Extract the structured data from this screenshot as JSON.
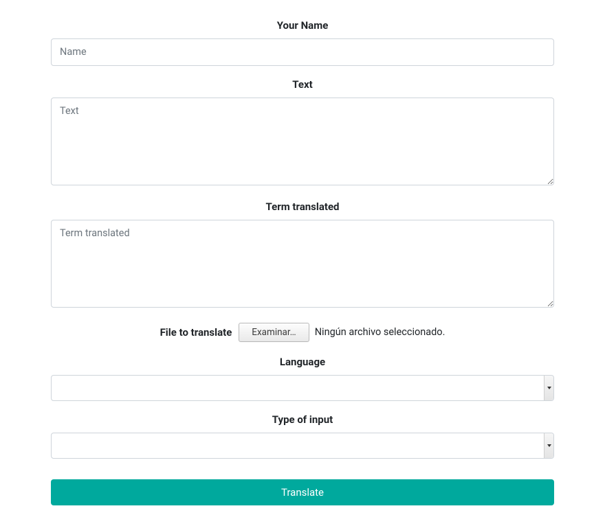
{
  "form": {
    "name": {
      "label": "Your Name",
      "placeholder": "Name",
      "value": ""
    },
    "text": {
      "label": "Text",
      "placeholder": "Text",
      "value": ""
    },
    "term_translated": {
      "label": "Term translated",
      "placeholder": "Term translated",
      "value": ""
    },
    "file": {
      "label": "File to translate",
      "button_label": "Examinar…",
      "status_text": "Ningún archivo seleccionado."
    },
    "language": {
      "label": "Language",
      "selected": ""
    },
    "input_type": {
      "label": "Type of input",
      "selected": ""
    },
    "submit_label": "Translate"
  },
  "colors": {
    "accent": "#00a99d"
  }
}
